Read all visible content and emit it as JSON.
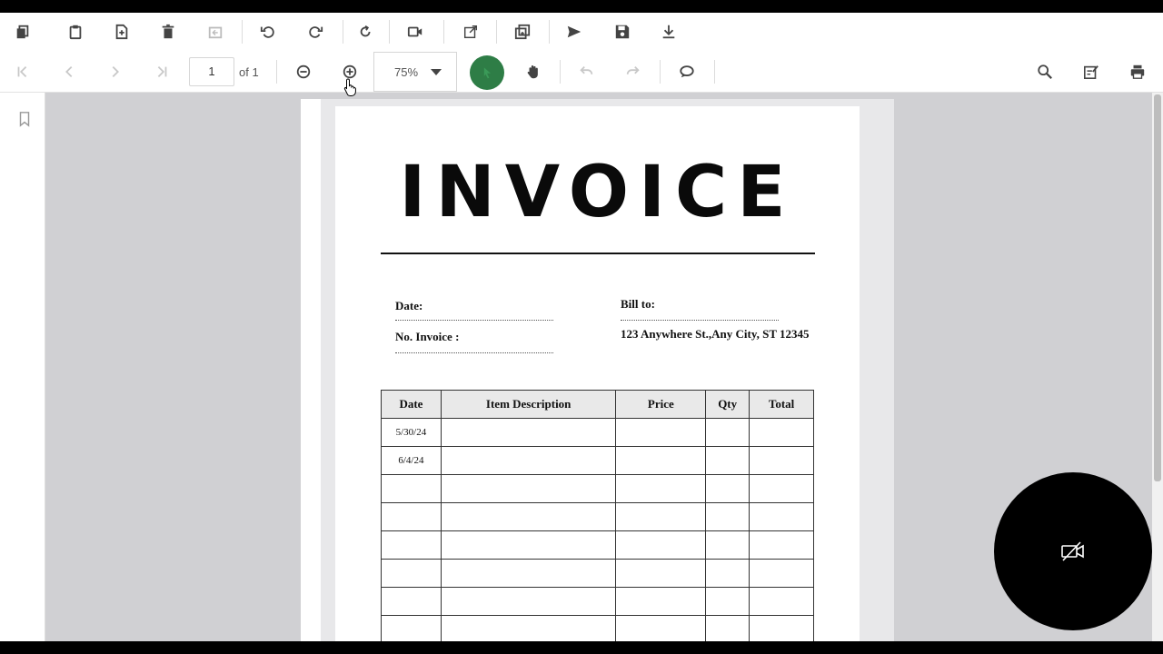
{
  "toolbar_primary": {
    "icons": [
      "copy-icon",
      "paste-icon",
      "insert-page-icon",
      "delete-icon",
      "extract-icon",
      "rotate-left-icon",
      "rotate-right-icon",
      "refresh-icon",
      "video-icon",
      "open-external-icon",
      "duplicate-icon",
      "send-icon",
      "save-icon",
      "download-icon"
    ]
  },
  "navigation": {
    "page_value": "1",
    "page_total_label": "of 1",
    "zoom_value": "75%"
  },
  "colors": {
    "accent_green": "#2e7d46",
    "viewer_bg": "#d0d0d3"
  },
  "document": {
    "title": "INVOICE",
    "date_label": "Date:",
    "invoice_no_label": "No. Invoice :",
    "bill_to_label": "Bill to:",
    "address": "123 Anywhere St.,Any City, ST 12345",
    "table": {
      "headers": [
        "Date",
        "Item Description",
        "Price",
        "Qty",
        "Total"
      ],
      "rows": [
        [
          "5/30/24",
          "",
          "",
          "",
          ""
        ],
        [
          "6/4/24",
          "",
          "",
          "",
          ""
        ],
        [
          "",
          "",
          "",
          "",
          ""
        ],
        [
          "",
          "",
          "",
          "",
          ""
        ],
        [
          "",
          "",
          "",
          "",
          ""
        ],
        [
          "",
          "",
          "",
          "",
          ""
        ],
        [
          "",
          "",
          "",
          "",
          ""
        ],
        [
          "",
          "",
          "",
          "",
          ""
        ]
      ]
    }
  }
}
